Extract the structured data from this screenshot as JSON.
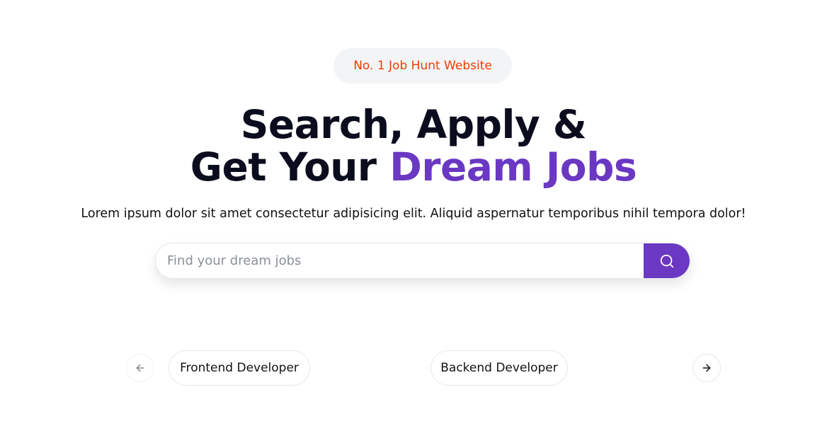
{
  "hero": {
    "badge": "No. 1 Job Hunt Website",
    "headline_line1": "Search, Apply &",
    "headline_line2_prefix": "Get Your ",
    "headline_line2_accent": "Dream Jobs",
    "subtitle": "Lorem ipsum dolor sit amet consectetur adipisicing elit. Aliquid aspernatur temporibus nihil tempora dolor!"
  },
  "search": {
    "placeholder": "Find your dream jobs",
    "value": "",
    "button_icon": "search-icon"
  },
  "carousel": {
    "prev_icon": "arrow-left-icon",
    "next_icon": "arrow-right-icon",
    "categories": [
      {
        "label": "Frontend Developer"
      },
      {
        "label": "Backend Developer"
      }
    ]
  },
  "colors": {
    "accent": "#6a38c2",
    "badge_text": "#f03c05",
    "badge_bg": "#f3f4f6",
    "headline": "#0b0d1e"
  }
}
